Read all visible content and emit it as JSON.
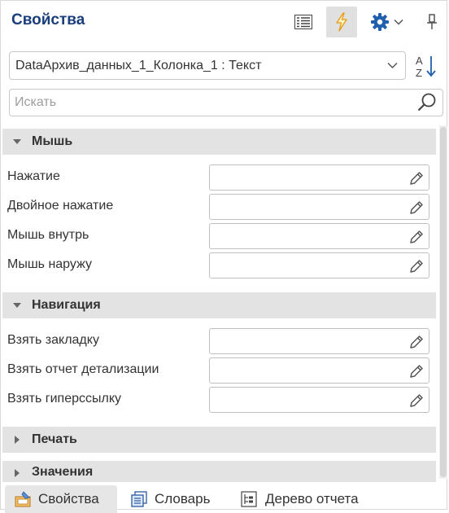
{
  "panel": {
    "title": "Свойства"
  },
  "toolbar": {
    "grid_icon": "property-grid-icon",
    "events_icon": "lightning-icon",
    "settings_icon": "gear-icon",
    "pin_icon": "pin-icon",
    "active_button": "events"
  },
  "object_selector": {
    "value": "DataАрхив_данных_1_Колонка_1 : Текст"
  },
  "search": {
    "placeholder": "Искать"
  },
  "categories": [
    {
      "label": "Мышь",
      "expanded": true,
      "items": [
        {
          "label": "Нажатие",
          "value": ""
        },
        {
          "label": "Двойное нажатие",
          "value": ""
        },
        {
          "label": "Мышь внутрь",
          "value": ""
        },
        {
          "label": "Мышь наружу",
          "value": ""
        }
      ]
    },
    {
      "label": "Навигация",
      "expanded": true,
      "items": [
        {
          "label": "Взять закладку",
          "value": ""
        },
        {
          "label": "Взять отчет детализации",
          "value": ""
        },
        {
          "label": "Взять гиперссылку",
          "value": ""
        }
      ]
    },
    {
      "label": "Печать",
      "expanded": false,
      "items": []
    },
    {
      "label": "Значения",
      "expanded": false,
      "items": []
    }
  ],
  "bottom_tabs": [
    {
      "label": "Свойства",
      "icon": "properties-icon",
      "active": true
    },
    {
      "label": "Словарь",
      "icon": "dictionary-icon",
      "active": false
    },
    {
      "label": "Дерево отчета",
      "icon": "report-tree-icon",
      "active": false
    }
  ],
  "colors": {
    "title": "#1a3d7c",
    "accent_gear": "#1f5fae",
    "lightning": "#f0a020",
    "category_bg": "#e3e3e3"
  }
}
